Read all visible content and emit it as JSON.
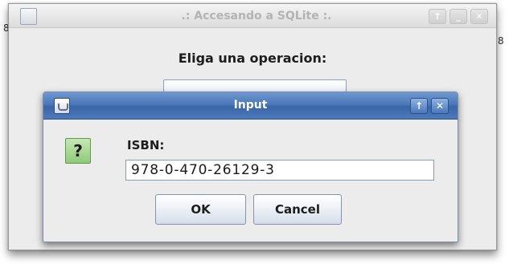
{
  "background_window": {
    "title": ".: Accesando a SQLite :.",
    "heading": "Eliga una operacion:",
    "side_left": "8",
    "side_right": "8",
    "controls": [
      "↑",
      "_",
      "✕"
    ]
  },
  "dialog": {
    "title": "Input",
    "controls": [
      "↑",
      "✕"
    ],
    "question_mark": "?",
    "label": "ISBN:",
    "input_value": "978-0-470-26129-3",
    "ok_label": "OK",
    "cancel_label": "Cancel"
  },
  "icons": {
    "window_icon": "java-icon",
    "message_icon": "question-icon"
  },
  "colors": {
    "titlebar_blue": "#4b78ba",
    "question_green": "#8fca78"
  }
}
